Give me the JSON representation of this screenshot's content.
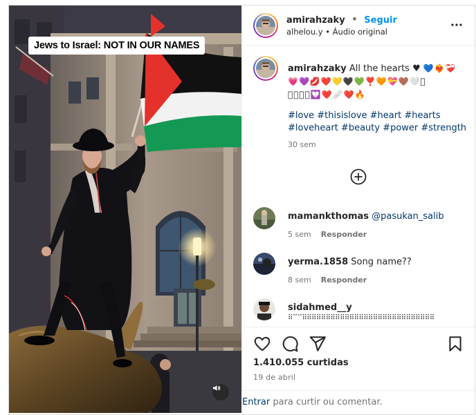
{
  "post": {
    "author": "amirahzaky",
    "separator": "•",
    "follow_label": "Seguir",
    "audio_attribution": "alhelou.y • Áudio original",
    "video_banner": "Jews to Israel: NOT IN OUR NAMES"
  },
  "caption": {
    "author": "amirahzaky",
    "text": "All the hearts ♥",
    "emoji_line1": [
      "💙",
      "❤️‍🔥",
      "❤️‍🩹"
    ],
    "emoji_line2": [
      "💗",
      "💜",
      "💋",
      "❤️",
      "💛",
      "🖤",
      "💚",
      "❣️",
      "🧡",
      "💝",
      "🤎",
      "🤍",
      "􏿽"
    ],
    "emoji_line3": [
      "􏿽",
      "􏿽",
      "􏿽",
      "􏿽",
      "💟",
      "❤️",
      "🩹",
      "❤️",
      "🔥"
    ],
    "hashtags_line1": "#love #thisislove #heart #hearts",
    "hashtags_line2": "#loveheart #beauty #power #strength",
    "time": "30 sem"
  },
  "comments": [
    {
      "author": "mamankthomas",
      "text": "@pasukan_salib",
      "time": "5 sem",
      "reply_label": "Responder"
    },
    {
      "author": "yerma.1858",
      "text": "Song name??",
      "time": "8 sem",
      "reply_label": "Responder"
    },
    {
      "author": "sidahmed__y",
      "text": "⠿⠉⠉⠿⠿⠿⠿⠿⠿⠿⠿⠿⠿⠿⠿⠿⠿⠿⠿⠿⠿⠿⠿⠿⠿⠿⠿⠿⠿⠿⠿",
      "time": "",
      "reply_label": ""
    }
  ],
  "stats": {
    "likes": "1.410.055 curtidas",
    "date": "19 de abril"
  },
  "input": {
    "prefix": "Entrar",
    "text": " para curtir ou comentar."
  },
  "icons": {
    "more": "more-options-icon",
    "load_more": "add-circle-icon",
    "like": "heart-icon",
    "comment": "comment-icon",
    "share": "share-icon",
    "save": "bookmark-icon",
    "audio": "speaker-icon"
  },
  "colors": {
    "follow": "#0095f6",
    "hashtag": "#00376b",
    "muted": "#737373",
    "flag_red": "#e4312b",
    "flag_green": "#149954",
    "flag_black": "#111111"
  }
}
